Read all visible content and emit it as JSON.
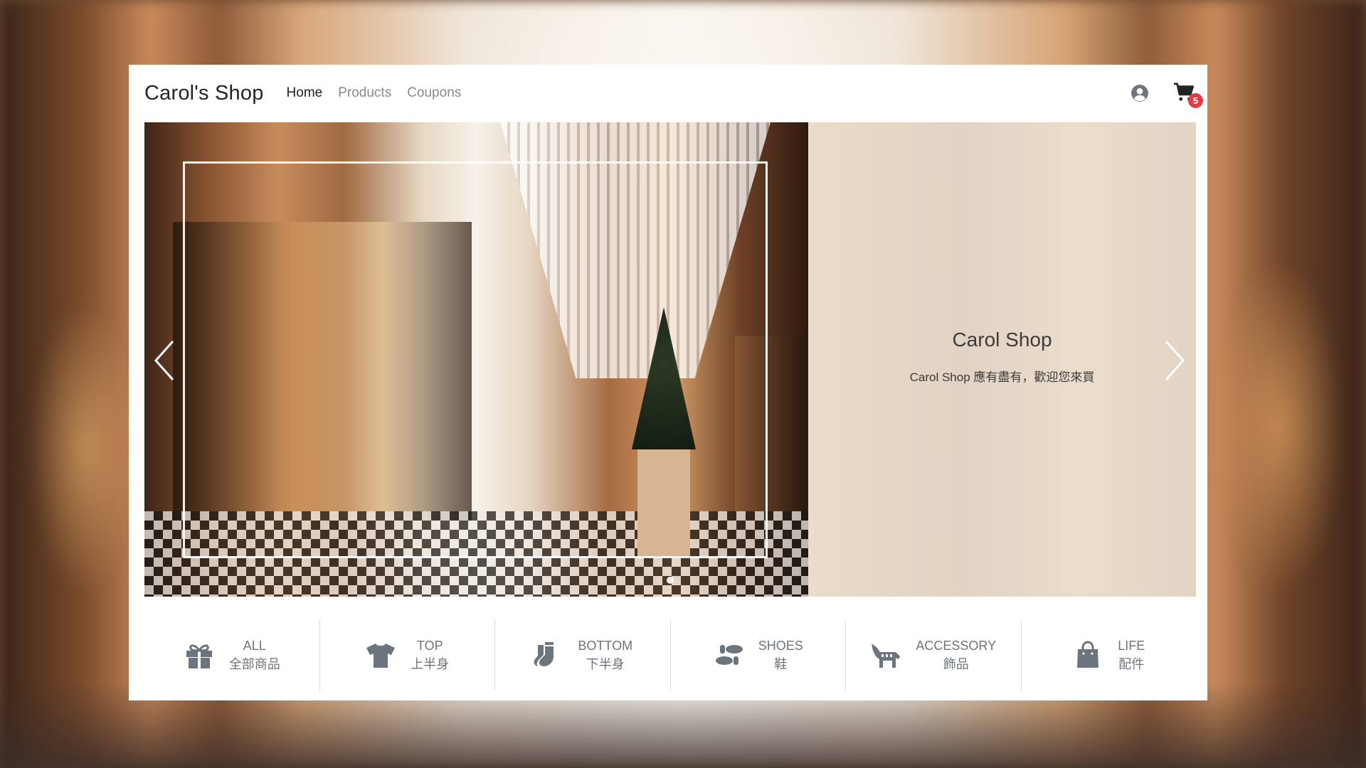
{
  "navbar": {
    "brand": "Carol's Shop",
    "links": [
      {
        "label": "Home",
        "active": true
      },
      {
        "label": "Products",
        "active": false
      },
      {
        "label": "Coupons",
        "active": false
      }
    ],
    "user_icon": "user-circle-icon",
    "cart": {
      "icon": "cart-icon",
      "count": "5",
      "badge_color": "#e03a45"
    }
  },
  "hero": {
    "title": "Carol Shop",
    "text": "Carol Shop 應有盡有，歡迎您來買",
    "prev_icon": "chevron-left-icon",
    "next_icon": "chevron-right-icon",
    "indicator_count": 1
  },
  "categories": [
    {
      "en": "ALL",
      "zh": "全部商品",
      "icon": "gift-icon"
    },
    {
      "en": "TOP",
      "zh": "上半身",
      "icon": "tshirt-icon"
    },
    {
      "en": "BOTTOM",
      "zh": "下半身",
      "icon": "socks-icon"
    },
    {
      "en": "SHOES",
      "zh": "鞋",
      "icon": "shoe-prints-icon"
    },
    {
      "en": "ACCESSORY",
      "zh": "飾品",
      "icon": "horse-icon"
    },
    {
      "en": "LIFE",
      "zh": "配件",
      "icon": "shopping-bag-icon"
    }
  ],
  "colors": {
    "icon_gray": "#6c757d",
    "text_dark": "#212529"
  }
}
